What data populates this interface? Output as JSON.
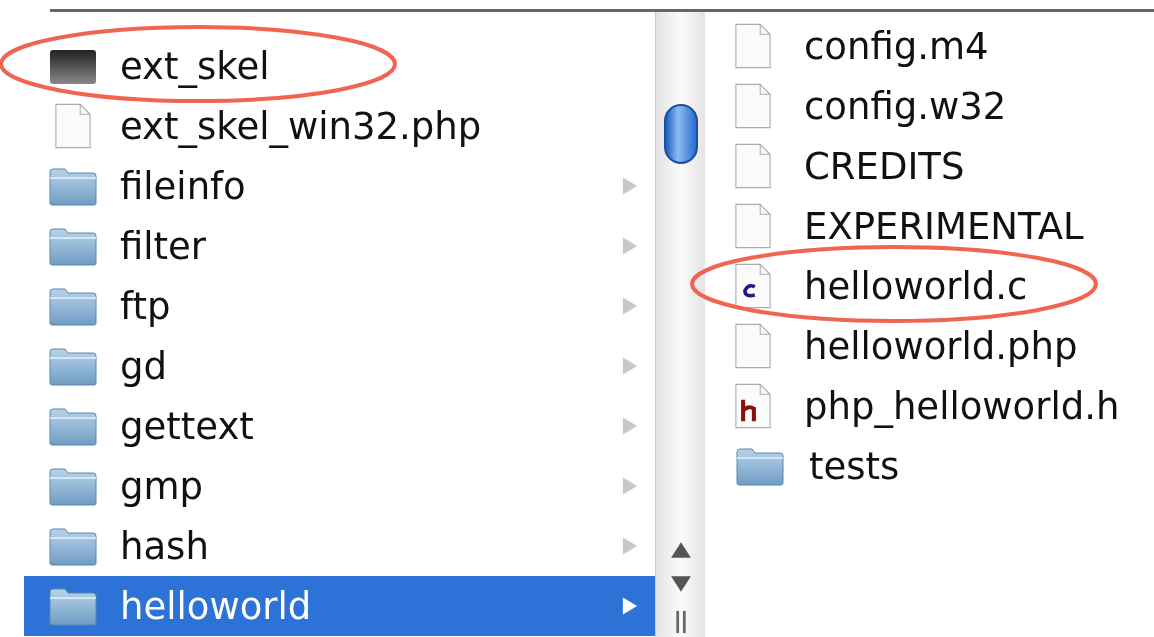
{
  "columns": [
    {
      "items": [
        {
          "name": "ext_skel",
          "kind": "exec",
          "arrow": false,
          "selected": false,
          "circled": true
        },
        {
          "name": "ext_skel_win32.php",
          "kind": "file",
          "arrow": false,
          "selected": false,
          "circled": false
        },
        {
          "name": "fileinfo",
          "kind": "folder",
          "arrow": true,
          "selected": false,
          "circled": false
        },
        {
          "name": "filter",
          "kind": "folder",
          "arrow": true,
          "selected": false,
          "circled": false
        },
        {
          "name": "ftp",
          "kind": "folder",
          "arrow": true,
          "selected": false,
          "circled": false
        },
        {
          "name": "gd",
          "kind": "folder",
          "arrow": true,
          "selected": false,
          "circled": false
        },
        {
          "name": "gettext",
          "kind": "folder",
          "arrow": true,
          "selected": false,
          "circled": false
        },
        {
          "name": "gmp",
          "kind": "folder",
          "arrow": true,
          "selected": false,
          "circled": false
        },
        {
          "name": "hash",
          "kind": "folder",
          "arrow": true,
          "selected": false,
          "circled": false
        },
        {
          "name": "helloworld",
          "kind": "folder",
          "arrow": true,
          "selected": true,
          "circled": false
        }
      ]
    },
    {
      "items": [
        {
          "name": "config.m4",
          "kind": "file",
          "arrow": false,
          "selected": false,
          "circled": false
        },
        {
          "name": "config.w32",
          "kind": "file",
          "arrow": false,
          "selected": false,
          "circled": false
        },
        {
          "name": "CREDITS",
          "kind": "file",
          "arrow": false,
          "selected": false,
          "circled": false
        },
        {
          "name": "EXPERIMENTAL",
          "kind": "file",
          "arrow": false,
          "selected": false,
          "circled": false
        },
        {
          "name": "helloworld.c",
          "kind": "c",
          "arrow": false,
          "selected": false,
          "circled": true
        },
        {
          "name": "helloworld.php",
          "kind": "file",
          "arrow": false,
          "selected": false,
          "circled": false
        },
        {
          "name": "php_helloworld.h",
          "kind": "h",
          "arrow": false,
          "selected": false,
          "circled": false
        },
        {
          "name": "tests",
          "kind": "folder",
          "arrow": false,
          "selected": false,
          "circled": false
        }
      ]
    }
  ]
}
